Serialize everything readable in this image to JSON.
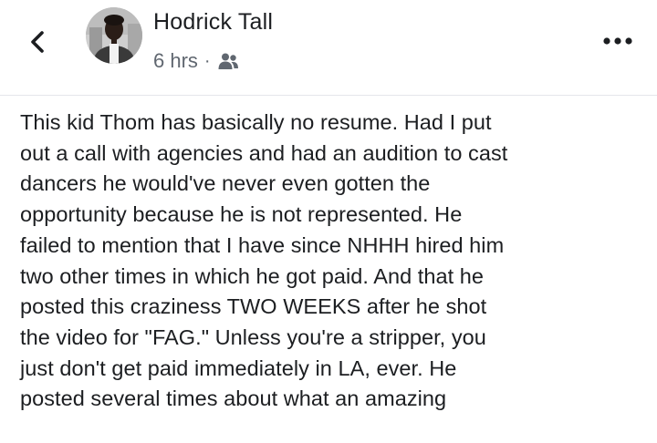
{
  "post": {
    "author": "Hodrick Tall",
    "timestamp": "6 hrs",
    "separator": "·",
    "audience_icon": "friends-icon",
    "lines": [
      "This kid Thom has basically no resume. Had I put",
      "out a call with agencies and had an audition to cast",
      "dancers he would've never even gotten the",
      "opportunity because he is not represented. He",
      "failed to mention that I have since NHHH hired him",
      "two other times in which he got paid. And that he",
      "posted this craziness TWO WEEKS after he shot",
      "the video for \"FAG.\" Unless you're a stripper, you",
      "just don't get paid immediately in LA, ever. He",
      "posted several times about what an amazing"
    ]
  },
  "icons": {
    "back": "back-arrow-icon",
    "more": "more-options-icon"
  },
  "colors": {
    "text": "#1c1e21",
    "meta": "#606770",
    "divider": "#e4e6eb"
  }
}
